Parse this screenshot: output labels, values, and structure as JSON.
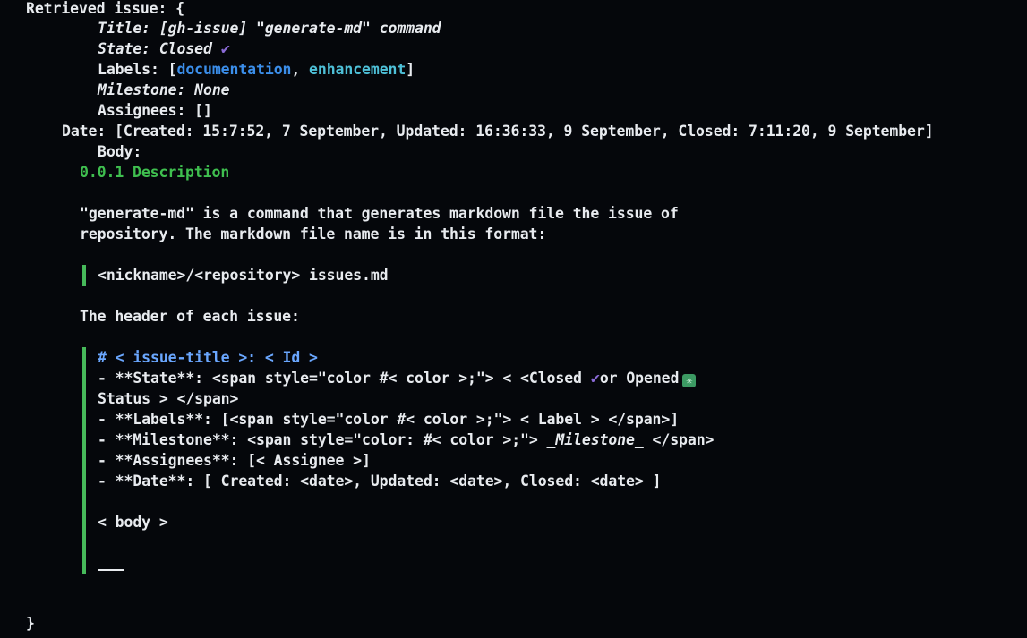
{
  "output": {
    "header": "Retrieved issue: {",
    "title": "Title: [gh-issue] \"generate-md\" command",
    "state": "State: Closed",
    "labels_prefix": "Labels: [",
    "label_documentation": "documentation",
    "label_sep": ", ",
    "label_enhancement": "enhancement",
    "labels_suffix": "]",
    "milestone": "Milestone: None",
    "assignees": "Assignees: []",
    "date": "Date: [Created: 15:7:52, 7 September, Updated: 16:36:33, 9 September, Closed: 7:11:20, 9 September]",
    "body_label": "Body:",
    "closing_brace": "}"
  },
  "body": {
    "heading": "0.0.1 Description",
    "paragraph_line1": "\"generate-md\" is a command that generates markdown file the issue of",
    "paragraph_line2": "repository. The markdown file name is in this format:",
    "quote_filename": "<nickname>/<repository> issues.md",
    "header_intro": "The header of each issue:",
    "template_heading": "# < issue-title >: < Id >",
    "state_line_part1": "- **State**: <span style=\"color #< color >;\"> < <Closed ",
    "state_line_part2": "or Opened",
    "state_line2": "Status > </span>",
    "labels_line": "- **Labels**: [<span style=\"color #< color >;\"> < Label > </span>]",
    "milestone_line_part1": "- **Milestone**: <span style=\"color: #< color >;\"> ",
    "milestone_line_italic": "_Milestone_",
    "milestone_line_part2": " </span>",
    "assignees_line": "- **Assignees**: [< Assignee >]",
    "date_line": "- **Date**: [ Created: <date>, Updated: <date>, Closed: <date> ]",
    "body_placeholder": "< body >"
  },
  "icons": {
    "check": "heavy-check-mark-icon",
    "sparkle": "sparkle-icon"
  },
  "colors": {
    "background": "#05070b",
    "text": "#e8ebef",
    "label_documentation": "#3b8eea",
    "label_enhancement": "#4ec0d8",
    "heading_green": "#3fbf4f",
    "quote_bar": "#46b95a",
    "template_heading": "#6aa7ff",
    "check": "#8a6ad6"
  }
}
